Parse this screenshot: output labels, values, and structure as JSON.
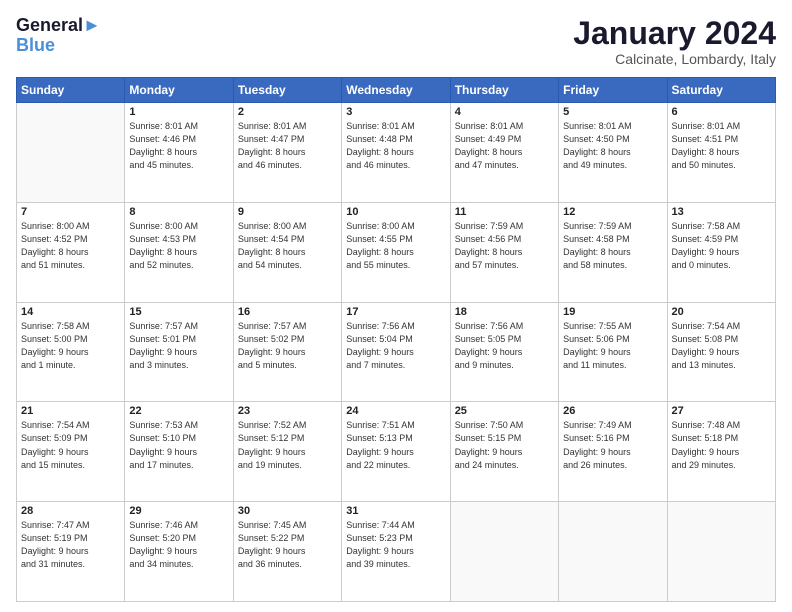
{
  "header": {
    "logo_line1": "General",
    "logo_line2": "Blue",
    "month": "January 2024",
    "location": "Calcinate, Lombardy, Italy"
  },
  "days_of_week": [
    "Sunday",
    "Monday",
    "Tuesday",
    "Wednesday",
    "Thursday",
    "Friday",
    "Saturday"
  ],
  "weeks": [
    [
      {
        "day": "",
        "info": ""
      },
      {
        "day": "1",
        "info": "Sunrise: 8:01 AM\nSunset: 4:46 PM\nDaylight: 8 hours\nand 45 minutes."
      },
      {
        "day": "2",
        "info": "Sunrise: 8:01 AM\nSunset: 4:47 PM\nDaylight: 8 hours\nand 46 minutes."
      },
      {
        "day": "3",
        "info": "Sunrise: 8:01 AM\nSunset: 4:48 PM\nDaylight: 8 hours\nand 46 minutes."
      },
      {
        "day": "4",
        "info": "Sunrise: 8:01 AM\nSunset: 4:49 PM\nDaylight: 8 hours\nand 47 minutes."
      },
      {
        "day": "5",
        "info": "Sunrise: 8:01 AM\nSunset: 4:50 PM\nDaylight: 8 hours\nand 49 minutes."
      },
      {
        "day": "6",
        "info": "Sunrise: 8:01 AM\nSunset: 4:51 PM\nDaylight: 8 hours\nand 50 minutes."
      }
    ],
    [
      {
        "day": "7",
        "info": "Sunrise: 8:00 AM\nSunset: 4:52 PM\nDaylight: 8 hours\nand 51 minutes."
      },
      {
        "day": "8",
        "info": "Sunrise: 8:00 AM\nSunset: 4:53 PM\nDaylight: 8 hours\nand 52 minutes."
      },
      {
        "day": "9",
        "info": "Sunrise: 8:00 AM\nSunset: 4:54 PM\nDaylight: 8 hours\nand 54 minutes."
      },
      {
        "day": "10",
        "info": "Sunrise: 8:00 AM\nSunset: 4:55 PM\nDaylight: 8 hours\nand 55 minutes."
      },
      {
        "day": "11",
        "info": "Sunrise: 7:59 AM\nSunset: 4:56 PM\nDaylight: 8 hours\nand 57 minutes."
      },
      {
        "day": "12",
        "info": "Sunrise: 7:59 AM\nSunset: 4:58 PM\nDaylight: 8 hours\nand 58 minutes."
      },
      {
        "day": "13",
        "info": "Sunrise: 7:58 AM\nSunset: 4:59 PM\nDaylight: 9 hours\nand 0 minutes."
      }
    ],
    [
      {
        "day": "14",
        "info": "Sunrise: 7:58 AM\nSunset: 5:00 PM\nDaylight: 9 hours\nand 1 minute."
      },
      {
        "day": "15",
        "info": "Sunrise: 7:57 AM\nSunset: 5:01 PM\nDaylight: 9 hours\nand 3 minutes."
      },
      {
        "day": "16",
        "info": "Sunrise: 7:57 AM\nSunset: 5:02 PM\nDaylight: 9 hours\nand 5 minutes."
      },
      {
        "day": "17",
        "info": "Sunrise: 7:56 AM\nSunset: 5:04 PM\nDaylight: 9 hours\nand 7 minutes."
      },
      {
        "day": "18",
        "info": "Sunrise: 7:56 AM\nSunset: 5:05 PM\nDaylight: 9 hours\nand 9 minutes."
      },
      {
        "day": "19",
        "info": "Sunrise: 7:55 AM\nSunset: 5:06 PM\nDaylight: 9 hours\nand 11 minutes."
      },
      {
        "day": "20",
        "info": "Sunrise: 7:54 AM\nSunset: 5:08 PM\nDaylight: 9 hours\nand 13 minutes."
      }
    ],
    [
      {
        "day": "21",
        "info": "Sunrise: 7:54 AM\nSunset: 5:09 PM\nDaylight: 9 hours\nand 15 minutes."
      },
      {
        "day": "22",
        "info": "Sunrise: 7:53 AM\nSunset: 5:10 PM\nDaylight: 9 hours\nand 17 minutes."
      },
      {
        "day": "23",
        "info": "Sunrise: 7:52 AM\nSunset: 5:12 PM\nDaylight: 9 hours\nand 19 minutes."
      },
      {
        "day": "24",
        "info": "Sunrise: 7:51 AM\nSunset: 5:13 PM\nDaylight: 9 hours\nand 22 minutes."
      },
      {
        "day": "25",
        "info": "Sunrise: 7:50 AM\nSunset: 5:15 PM\nDaylight: 9 hours\nand 24 minutes."
      },
      {
        "day": "26",
        "info": "Sunrise: 7:49 AM\nSunset: 5:16 PM\nDaylight: 9 hours\nand 26 minutes."
      },
      {
        "day": "27",
        "info": "Sunrise: 7:48 AM\nSunset: 5:18 PM\nDaylight: 9 hours\nand 29 minutes."
      }
    ],
    [
      {
        "day": "28",
        "info": "Sunrise: 7:47 AM\nSunset: 5:19 PM\nDaylight: 9 hours\nand 31 minutes."
      },
      {
        "day": "29",
        "info": "Sunrise: 7:46 AM\nSunset: 5:20 PM\nDaylight: 9 hours\nand 34 minutes."
      },
      {
        "day": "30",
        "info": "Sunrise: 7:45 AM\nSunset: 5:22 PM\nDaylight: 9 hours\nand 36 minutes."
      },
      {
        "day": "31",
        "info": "Sunrise: 7:44 AM\nSunset: 5:23 PM\nDaylight: 9 hours\nand 39 minutes."
      },
      {
        "day": "",
        "info": ""
      },
      {
        "day": "",
        "info": ""
      },
      {
        "day": "",
        "info": ""
      }
    ]
  ]
}
